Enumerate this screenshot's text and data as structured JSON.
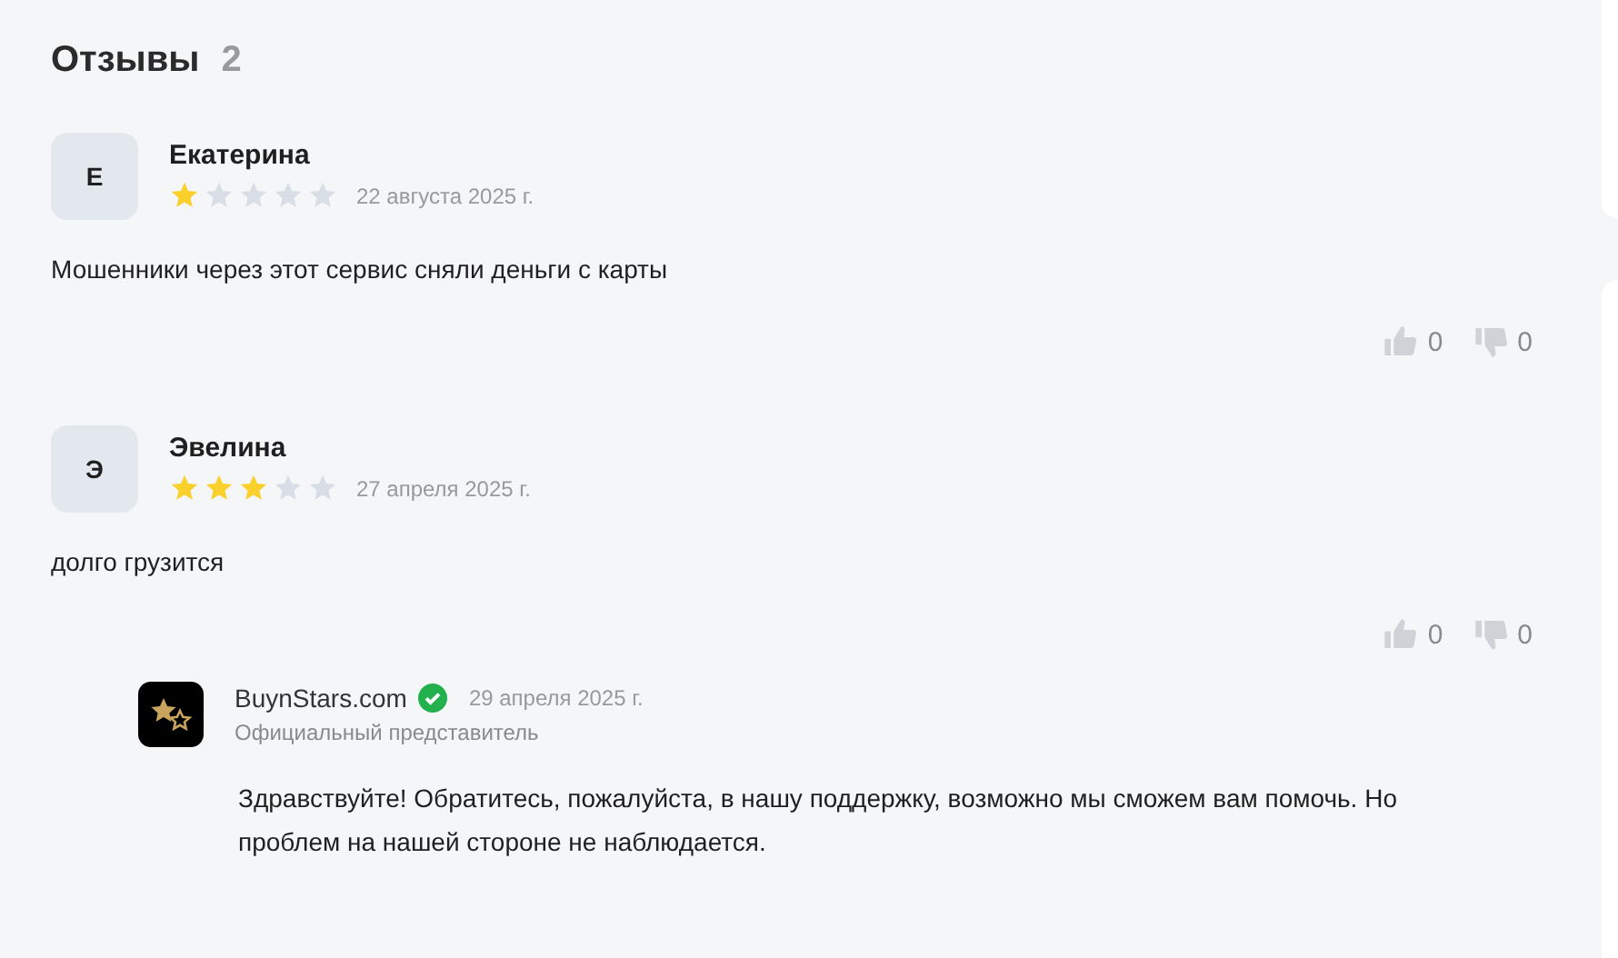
{
  "heading": {
    "title": "Отзывы",
    "count": "2"
  },
  "reviews": [
    {
      "initial": "Е",
      "author": "Екатерина",
      "stars": 1,
      "date": "22 августа 2025 г.",
      "text": "Мошенники через этот сервис сняли деньги с карты",
      "likes": "0",
      "dislikes": "0"
    },
    {
      "initial": "Э",
      "author": "Эвелина",
      "stars": 3,
      "date": "27 апреля 2025 г.",
      "text": "долго грузится",
      "likes": "0",
      "dislikes": "0",
      "reply": {
        "author": "BuynStars.com",
        "verified": true,
        "date": "29 апреля 2025 г.",
        "role": "Официальный представитель",
        "text": "Здравствуйте! Обратитесь, пожалуйста, в нашу поддержку, возможно мы сможем вам помочь. Но проблем на нашей стороне не наблюдается."
      }
    }
  ]
}
